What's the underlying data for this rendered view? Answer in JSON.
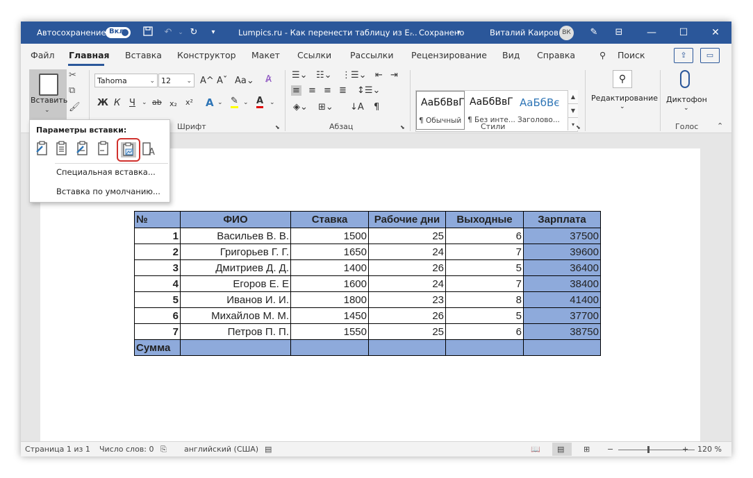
{
  "titlebar": {
    "autosave_label": "Автосохранение",
    "autosave_state": "Вкл.",
    "doc_title": "Lumpics.ru - Как перенести таблицу из E...",
    "save_status": "Сохранено",
    "user_name": "Виталий Каиров",
    "user_initials": "ВК"
  },
  "menu": {
    "tabs": [
      "Файл",
      "Главная",
      "Вставка",
      "Конструктор",
      "Макет",
      "Ссылки",
      "Рассылки",
      "Рецензирование",
      "Вид",
      "Справка"
    ],
    "search_label": "Поиск",
    "active_tab": "Главная"
  },
  "ribbon": {
    "paste_label": "Вставить",
    "font_name": "Tahoma",
    "font_size": "12",
    "groups": {
      "clipboard": "Б",
      "font": "Шрифт",
      "paragraph": "Абзац",
      "styles": "Стили",
      "voice": "Голос"
    },
    "styles": [
      {
        "preview": "АаБбВвГ",
        "name": "¶ Обычный"
      },
      {
        "preview": "АаБбВвГ",
        "name": "¶ Без инте..."
      },
      {
        "preview": "АаБбВє",
        "name": "Заголово..."
      }
    ],
    "editing_label": "Редактирование",
    "dictate_label": "Диктофон"
  },
  "paste_popup": {
    "title": "Параметры вставки:",
    "special_paste": "Специальная вставка...",
    "default_paste": "Вставка по умолчанию..."
  },
  "table": {
    "headers": [
      "№",
      "ФИО",
      "Ставка",
      "Рабочие дни",
      "Выходные",
      "Зарплата"
    ],
    "rows": [
      [
        "1",
        "Васильев В. В.",
        "1500",
        "25",
        "6",
        "37500"
      ],
      [
        "2",
        "Григорьев Г. Г.",
        "1650",
        "24",
        "7",
        "39600"
      ],
      [
        "3",
        "Дмитриев Д. Д.",
        "1400",
        "26",
        "5",
        "36400"
      ],
      [
        "4",
        "Егоров Е. Е",
        "1600",
        "24",
        "7",
        "38400"
      ],
      [
        "5",
        "Иванов И. И.",
        "1800",
        "23",
        "8",
        "41400"
      ],
      [
        "6",
        "Михайлов М. М.",
        "1450",
        "26",
        "5",
        "37700"
      ],
      [
        "7",
        "Петров П. П.",
        "1550",
        "25",
        "6",
        "38750"
      ]
    ],
    "footer_label": "Сумма"
  },
  "statusbar": {
    "page": "Страница 1 из 1",
    "words": "Число слов: 0",
    "language": "английский (США)",
    "zoom": "120 %"
  },
  "colors": {
    "title_bar": "#2b579a",
    "table_header": "#8eaadb",
    "highlight_border": "#d0312d"
  }
}
